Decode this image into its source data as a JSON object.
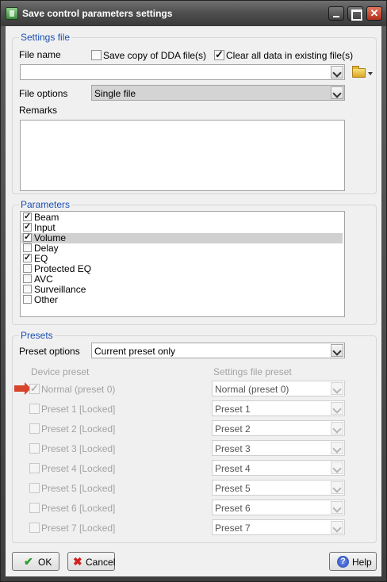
{
  "window": {
    "title": "Save control parameters settings"
  },
  "settings_file": {
    "legend": "Settings file",
    "file_name_label": "File name",
    "save_copy_dda_label": "Save copy of DDA file(s)",
    "save_copy_dda_checked": false,
    "clear_all_data_label": "Clear all data in existing file(s)",
    "clear_all_data_checked": true,
    "file_name_value": "",
    "file_options_label": "File options",
    "file_options_value": "Single file",
    "remarks_label": "Remarks",
    "remarks_value": ""
  },
  "parameters": {
    "legend": "Parameters",
    "items": [
      {
        "label": "Beam",
        "checked": true,
        "selected": false
      },
      {
        "label": "Input",
        "checked": true,
        "selected": false
      },
      {
        "label": "Volume",
        "checked": true,
        "selected": true
      },
      {
        "label": "Delay",
        "checked": false,
        "selected": false
      },
      {
        "label": "EQ",
        "checked": true,
        "selected": false
      },
      {
        "label": "Protected EQ",
        "checked": false,
        "selected": false
      },
      {
        "label": "AVC",
        "checked": false,
        "selected": false
      },
      {
        "label": "Surveillance",
        "checked": false,
        "selected": false
      },
      {
        "label": "Other",
        "checked": false,
        "selected": false
      }
    ]
  },
  "presets": {
    "legend": "Presets",
    "preset_options_label": "Preset options",
    "preset_options_value": "Current preset only",
    "device_preset_header": "Device preset",
    "settings_file_preset_header": "Settings file preset",
    "rows": [
      {
        "device": "Normal (preset 0)",
        "checked": true,
        "file_preset": "Normal (preset 0)",
        "current": true
      },
      {
        "device": "Preset 1 [Locked]",
        "checked": false,
        "file_preset": "Preset 1",
        "current": false
      },
      {
        "device": "Preset 2 [Locked]",
        "checked": false,
        "file_preset": "Preset 2",
        "current": false
      },
      {
        "device": "Preset 3 [Locked]",
        "checked": false,
        "file_preset": "Preset 3",
        "current": false
      },
      {
        "device": "Preset 4 [Locked]",
        "checked": false,
        "file_preset": "Preset 4",
        "current": false
      },
      {
        "device": "Preset 5 [Locked]",
        "checked": false,
        "file_preset": "Preset 5",
        "current": false
      },
      {
        "device": "Preset 6 [Locked]",
        "checked": false,
        "file_preset": "Preset 6",
        "current": false
      },
      {
        "device": "Preset 7 [Locked]",
        "checked": false,
        "file_preset": "Preset 7",
        "current": false
      }
    ]
  },
  "buttons": {
    "ok": "OK",
    "cancel": "Cancel",
    "help": "Help"
  },
  "colors": {
    "legend": "#1a4fb5",
    "ok_check": "#2c9c2c",
    "cancel_x": "#d42020",
    "current_preset_arrow": "#d8432c"
  }
}
